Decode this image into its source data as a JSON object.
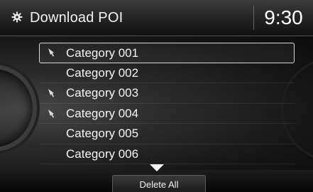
{
  "header": {
    "title": "Download POI",
    "time": "9:30",
    "icon": "gear-icon"
  },
  "list": {
    "items": [
      {
        "label": "Category 001",
        "has_marker": true,
        "selected": true
      },
      {
        "label": "Category 002",
        "has_marker": false,
        "selected": false
      },
      {
        "label": "Category 003",
        "has_marker": true,
        "selected": false
      },
      {
        "label": "Category 004",
        "has_marker": true,
        "selected": false
      },
      {
        "label": "Category 005",
        "has_marker": false,
        "selected": false
      },
      {
        "label": "Category 006",
        "has_marker": false,
        "selected": false
      }
    ]
  },
  "footer": {
    "delete_all_label": "Delete All",
    "scroll_indicator": "down-arrow-icon"
  },
  "colors": {
    "text": "#ffffff",
    "selection_border": "#d9d9d9",
    "header_bg": "#2a2a2a"
  }
}
